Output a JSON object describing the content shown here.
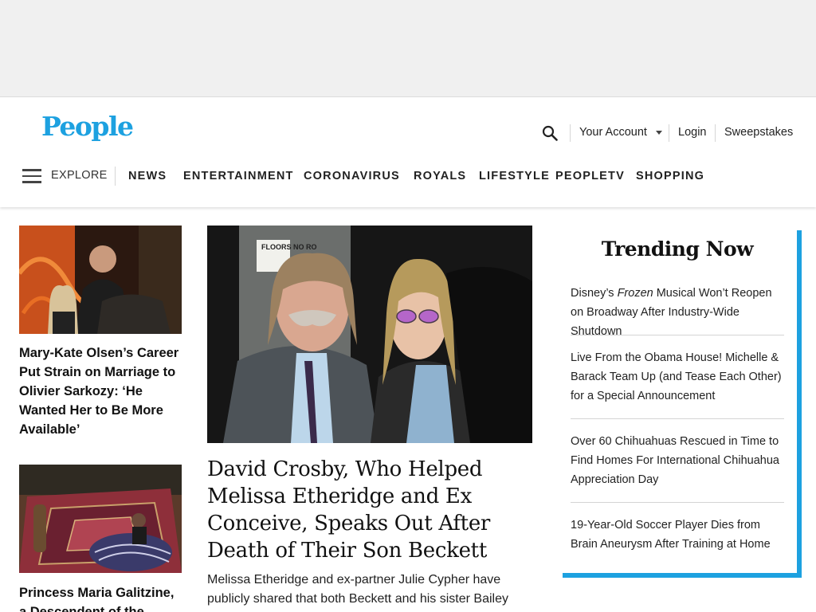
{
  "brand": {
    "logo_text": "People",
    "accent_color": "#1da1e0"
  },
  "header": {
    "search_icon": "search-icon",
    "account_label": "Your Account",
    "login_label": "Login",
    "sweepstakes_label": "Sweepstakes"
  },
  "nav": {
    "menu_icon": "hamburger-menu-icon",
    "explore_label": "EXPLORE",
    "items": [
      "NEWS",
      "ENTERTAINMENT",
      "CORONAVIRUS",
      "ROYALS",
      "LIFESTYLE",
      "PEOPLETV",
      "SHOPPING"
    ]
  },
  "left_cards": [
    {
      "title": "Mary-Kate Olsen’s Career Put Strain on Marriage to Olivier Sarkozy: ‘He Wanted Her to Be More Available’"
    },
    {
      "title": "Princess Maria Galitzine, a Descendent of the"
    }
  ],
  "feature": {
    "title": "David Crosby, Who Helped Melissa Etheridge and Ex Conceive, Speaks Out After Death of Their Son Beckett",
    "dek": "Melissa Etheridge and ex-partner Julie Cypher have publicly shared that both Beckett and his sister Bailey",
    "sign_text": "FLOORS NO RO"
  },
  "trending": {
    "title": "Trending Now",
    "items": [
      {
        "prefix": "Disney’s ",
        "emphasis": "Frozen",
        "suffix": " Musical Won’t Reopen on Broadway After Industry-Wide Shutdown"
      },
      {
        "prefix": "Live From the Obama House! Michelle & Barack Team Up (and Tease Each Other) for a Special Announcement",
        "emphasis": "",
        "suffix": ""
      },
      {
        "prefix": "Over 60 Chihuahuas Rescued in Time to Find Homes For International Chihuahua Appreciation Day",
        "emphasis": "",
        "suffix": ""
      },
      {
        "prefix": "19-Year-Old Soccer Player Dies from Brain Aneurysm After Training at Home",
        "emphasis": "",
        "suffix": ""
      }
    ]
  }
}
